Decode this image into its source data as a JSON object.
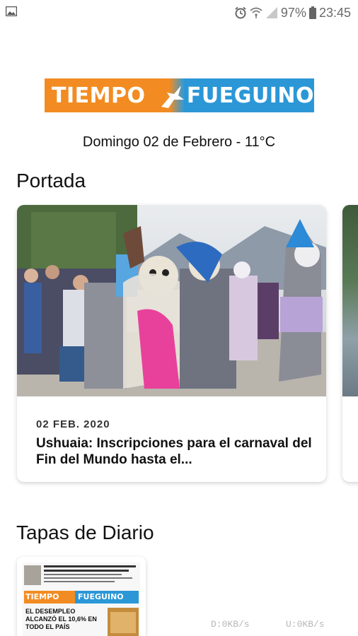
{
  "status_bar": {
    "battery": "97%",
    "time": "23:45",
    "icons": [
      "image-icon",
      "alarm-icon",
      "wifi-icon",
      "signal-icon",
      "battery-icon"
    ]
  },
  "logo": {
    "left": "TIEMPO",
    "right": "FUEGUINO",
    "colors": {
      "orange": "#f28c22",
      "blue": "#2b97d7"
    }
  },
  "dateline": "Domingo 02 de Febrero - 11°C",
  "sections": {
    "portada": "Portada",
    "tapas": "Tapas de Diario"
  },
  "cards": [
    {
      "date": "02 FEB. 2020",
      "title": "Ushuaia: Inscripciones para el carnaval del Fin del Mundo hasta el..."
    }
  ],
  "tapa": {
    "logo_left": "TIEMPO",
    "logo_right": "FUEGUINO",
    "headline": "EL DESEMPLEO ALCANZÓ EL 10,6% EN TODO EL PAÍS"
  },
  "netspeed": {
    "down": "D:0KB/s",
    "up": "U:0KB/s"
  }
}
